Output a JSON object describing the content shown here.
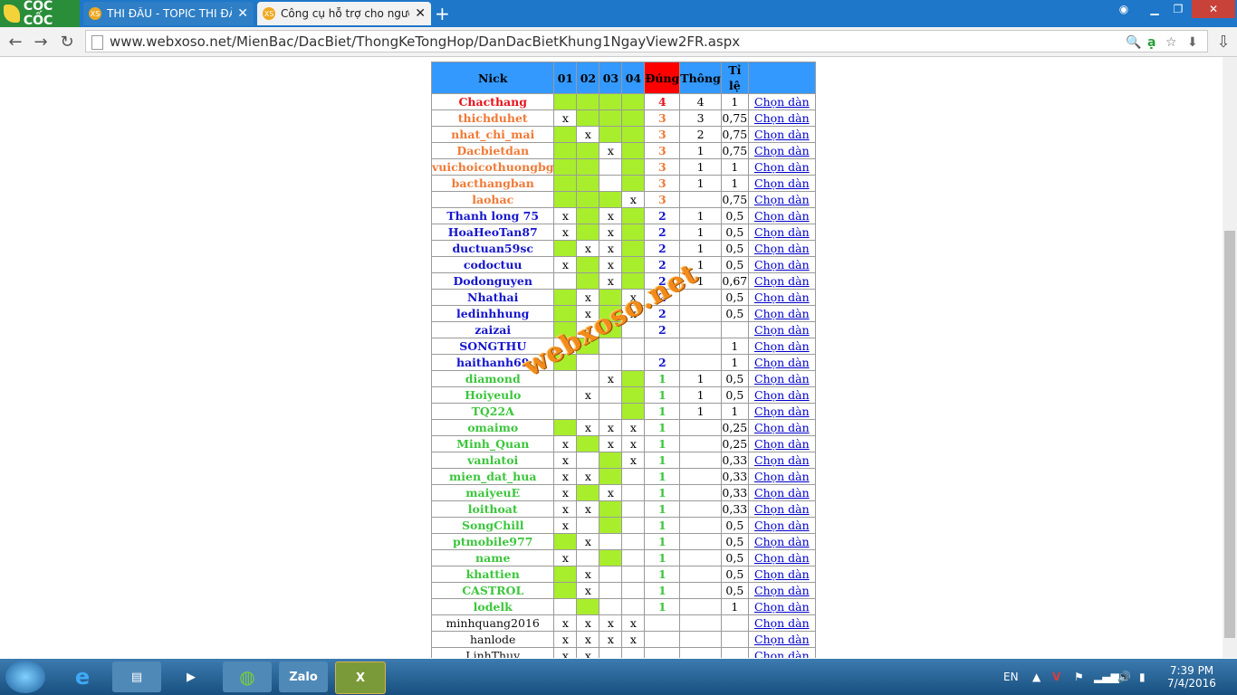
{
  "browser": {
    "brand": "CỐC CỐC",
    "tabs": [
      {
        "label": "THI ĐẤU - TOPIC THI ĐẤU",
        "favicon": "XS",
        "active": false
      },
      {
        "label": "Công cụ hỗ trợ cho người",
        "favicon": "XS",
        "active": true
      }
    ],
    "url": "www.webxoso.net/MienBac/DacBiet/ThongKeTongHop/DanDacBietKhung1NgayView2FR.aspx"
  },
  "table": {
    "headers": [
      "Nick",
      "01",
      "02",
      "03",
      "04",
      "Đúng",
      "Thông",
      "Tỉ lệ",
      ""
    ],
    "rows": [
      {
        "nick": "Chacthang",
        "cls": "red",
        "c": [
          "g",
          "g",
          "g",
          "g"
        ],
        "dung": "4",
        "thong": "4",
        "tile": "1",
        "chon": "Chọn dàn"
      },
      {
        "nick": "thichduhet",
        "cls": "orange",
        "c": [
          "x",
          "g",
          "g",
          "g"
        ],
        "dung": "3",
        "thong": "3",
        "tile": "0,75",
        "chon": "Chọn dàn"
      },
      {
        "nick": "nhat_chi_mai",
        "cls": "orange",
        "c": [
          "g",
          "x",
          "g",
          "g"
        ],
        "dung": "3",
        "thong": "2",
        "tile": "0,75",
        "chon": "Chọn dàn"
      },
      {
        "nick": "Dacbietdan",
        "cls": "orange",
        "c": [
          "g",
          "g",
          "x",
          "g"
        ],
        "dung": "3",
        "thong": "1",
        "tile": "0,75",
        "chon": "Chọn dàn"
      },
      {
        "nick": "vuichoicothuongbg",
        "cls": "orange",
        "c": [
          "g",
          "g",
          "",
          "g"
        ],
        "dung": "3",
        "thong": "1",
        "tile": "1",
        "chon": "Chọn dàn"
      },
      {
        "nick": "bacthangban",
        "cls": "orange",
        "c": [
          "g",
          "g",
          "",
          "g"
        ],
        "dung": "3",
        "thong": "1",
        "tile": "1",
        "chon": "Chọn dàn"
      },
      {
        "nick": "laohac",
        "cls": "orange",
        "c": [
          "g",
          "g",
          "g",
          "x"
        ],
        "dung": "3",
        "thong": "",
        "tile": "0,75",
        "chon": "Chọn dàn"
      },
      {
        "nick": "Thanh long 75",
        "cls": "blue",
        "c": [
          "x",
          "g",
          "x",
          "g"
        ],
        "dung": "2",
        "thong": "1",
        "tile": "0,5",
        "chon": "Chọn dàn"
      },
      {
        "nick": "HoaHeoTan87",
        "cls": "blue",
        "c": [
          "x",
          "g",
          "x",
          "g"
        ],
        "dung": "2",
        "thong": "1",
        "tile": "0,5",
        "chon": "Chọn dàn"
      },
      {
        "nick": "ductuan59sc",
        "cls": "blue",
        "c": [
          "g",
          "x",
          "x",
          "g"
        ],
        "dung": "2",
        "thong": "1",
        "tile": "0,5",
        "chon": "Chọn dàn"
      },
      {
        "nick": "codoctuu",
        "cls": "blue",
        "c": [
          "x",
          "g",
          "x",
          "g"
        ],
        "dung": "2",
        "thong": "1",
        "tile": "0,5",
        "chon": "Chọn dàn"
      },
      {
        "nick": "Dodonguyen",
        "cls": "blue",
        "c": [
          "",
          "g",
          "x",
          "g"
        ],
        "dung": "2",
        "thong": "1",
        "tile": "0,67",
        "chon": "Chọn dàn"
      },
      {
        "nick": "Nhathai",
        "cls": "blue",
        "c": [
          "g",
          "x",
          "g",
          "x"
        ],
        "dung": "2",
        "thong": "",
        "tile": "0,5",
        "chon": "Chọn dàn"
      },
      {
        "nick": "ledinhhung",
        "cls": "blue",
        "c": [
          "g",
          "x",
          "g",
          "x"
        ],
        "dung": "2",
        "thong": "",
        "tile": "0,5",
        "chon": "Chọn dàn"
      },
      {
        "nick": "zaizai",
        "cls": "blue",
        "c": [
          "g",
          "",
          "g",
          ""
        ],
        "dung": "2",
        "thong": "",
        "tile": "",
        "chon": "Chọn dàn"
      },
      {
        "nick": "SONGTHU",
        "cls": "blue",
        "c": [
          "",
          "g",
          "",
          ""
        ],
        "dung": "",
        "thong": "",
        "tile": "1",
        "chon": "Chọn dàn"
      },
      {
        "nick": "haithanh69",
        "cls": "blue",
        "c": [
          "g",
          "",
          "",
          ""
        ],
        "dung": "2",
        "thong": "",
        "tile": "1",
        "chon": "Chọn dàn"
      },
      {
        "nick": "diamond",
        "cls": "green",
        "c": [
          "",
          "",
          "x",
          "g"
        ],
        "dung": "1",
        "thong": "1",
        "tile": "0,5",
        "chon": "Chọn dàn"
      },
      {
        "nick": "Hoiyeulo",
        "cls": "green",
        "c": [
          "",
          "x",
          "",
          "g"
        ],
        "dung": "1",
        "thong": "1",
        "tile": "0,5",
        "chon": "Chọn dàn"
      },
      {
        "nick": "TQ22A",
        "cls": "green",
        "c": [
          "",
          "",
          "",
          "g"
        ],
        "dung": "1",
        "thong": "1",
        "tile": "1",
        "chon": "Chọn dàn"
      },
      {
        "nick": "omaimo",
        "cls": "green",
        "c": [
          "g",
          "x",
          "x",
          "x"
        ],
        "dung": "1",
        "thong": "",
        "tile": "0,25",
        "chon": "Chọn dàn"
      },
      {
        "nick": "Minh_Quan",
        "cls": "green",
        "c": [
          "x",
          "g",
          "x",
          "x"
        ],
        "dung": "1",
        "thong": "",
        "tile": "0,25",
        "chon": "Chọn dàn"
      },
      {
        "nick": "vanlatoi",
        "cls": "green",
        "c": [
          "x",
          "",
          "g",
          "x"
        ],
        "dung": "1",
        "thong": "",
        "tile": "0,33",
        "chon": "Chọn dàn"
      },
      {
        "nick": "mien_dat_hua",
        "cls": "green",
        "c": [
          "x",
          "x",
          "g",
          ""
        ],
        "dung": "1",
        "thong": "",
        "tile": "0,33",
        "chon": "Chọn dàn"
      },
      {
        "nick": "maiyeuE",
        "cls": "green",
        "c": [
          "x",
          "g",
          "x",
          ""
        ],
        "dung": "1",
        "thong": "",
        "tile": "0,33",
        "chon": "Chọn dàn"
      },
      {
        "nick": "loithoat",
        "cls": "green",
        "c": [
          "x",
          "x",
          "g",
          ""
        ],
        "dung": "1",
        "thong": "",
        "tile": "0,33",
        "chon": "Chọn dàn"
      },
      {
        "nick": "SongChill",
        "cls": "green",
        "c": [
          "x",
          "",
          "g",
          ""
        ],
        "dung": "1",
        "thong": "",
        "tile": "0,5",
        "chon": "Chọn dàn"
      },
      {
        "nick": "ptmobile977",
        "cls": "green",
        "c": [
          "g",
          "x",
          "",
          ""
        ],
        "dung": "1",
        "thong": "",
        "tile": "0,5",
        "chon": "Chọn dàn"
      },
      {
        "nick": "name",
        "cls": "green",
        "c": [
          "x",
          "",
          "g",
          ""
        ],
        "dung": "1",
        "thong": "",
        "tile": "0,5",
        "chon": "Chọn dàn"
      },
      {
        "nick": "khattien",
        "cls": "green",
        "c": [
          "g",
          "x",
          "",
          ""
        ],
        "dung": "1",
        "thong": "",
        "tile": "0,5",
        "chon": "Chọn dàn"
      },
      {
        "nick": "CASTROL",
        "cls": "green",
        "c": [
          "g",
          "x",
          "",
          ""
        ],
        "dung": "1",
        "thong": "",
        "tile": "0,5",
        "chon": "Chọn dàn"
      },
      {
        "nick": "lodelk",
        "cls": "green",
        "c": [
          "",
          "g",
          "",
          ""
        ],
        "dung": "1",
        "thong": "",
        "tile": "1",
        "chon": "Chọn dàn"
      },
      {
        "nick": "minhquang2016",
        "cls": "black",
        "c": [
          "x",
          "x",
          "x",
          "x"
        ],
        "dung": "",
        "thong": "",
        "tile": "",
        "chon": "Chọn dàn"
      },
      {
        "nick": "hanlode",
        "cls": "black",
        "c": [
          "x",
          "x",
          "x",
          "x"
        ],
        "dung": "",
        "thong": "",
        "tile": "",
        "chon": "Chọn dàn"
      },
      {
        "nick": "LinhThuy",
        "cls": "black",
        "c": [
          "x",
          "x",
          "",
          ""
        ],
        "dung": "",
        "thong": "",
        "tile": "",
        "chon": "Chọn dàn"
      }
    ]
  },
  "watermark": "webxoso.net",
  "taskbar": {
    "apps": [
      "Internet Explorer",
      "File Explorer",
      "Media Player",
      "Cốc Cốc",
      "Zalo",
      "Excel"
    ],
    "zalo_label": "Zalo",
    "language": "EN",
    "time": "7:39 PM",
    "date": "7/4/2016"
  }
}
